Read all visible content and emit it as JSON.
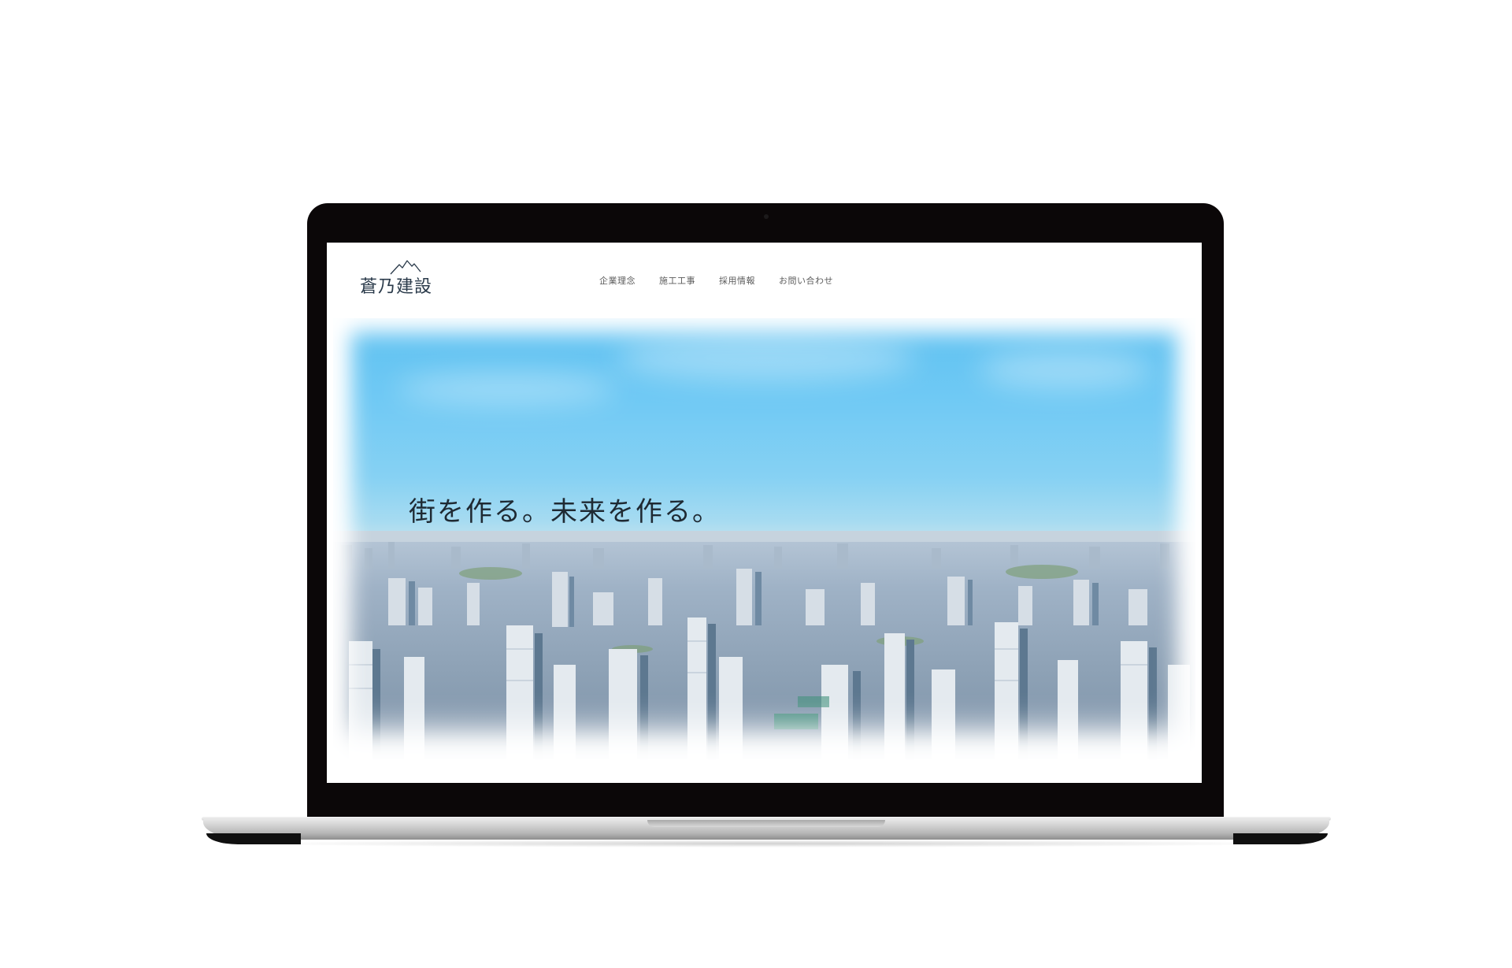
{
  "site": {
    "logo_text": "蒼乃建設",
    "nav": [
      {
        "label": "企業理念"
      },
      {
        "label": "施工工事"
      },
      {
        "label": "採用情報"
      },
      {
        "label": "お問い合わせ"
      }
    ],
    "hero": {
      "tagline": "街を作る。未来を作る。"
    }
  },
  "colors": {
    "sky_top": "#5ec1f1",
    "text_dark": "#1f2a33",
    "nav_text": "#5b5b5b",
    "bezel": "#0b0708"
  },
  "icons": {
    "logo_mark": "mountain-icon"
  }
}
